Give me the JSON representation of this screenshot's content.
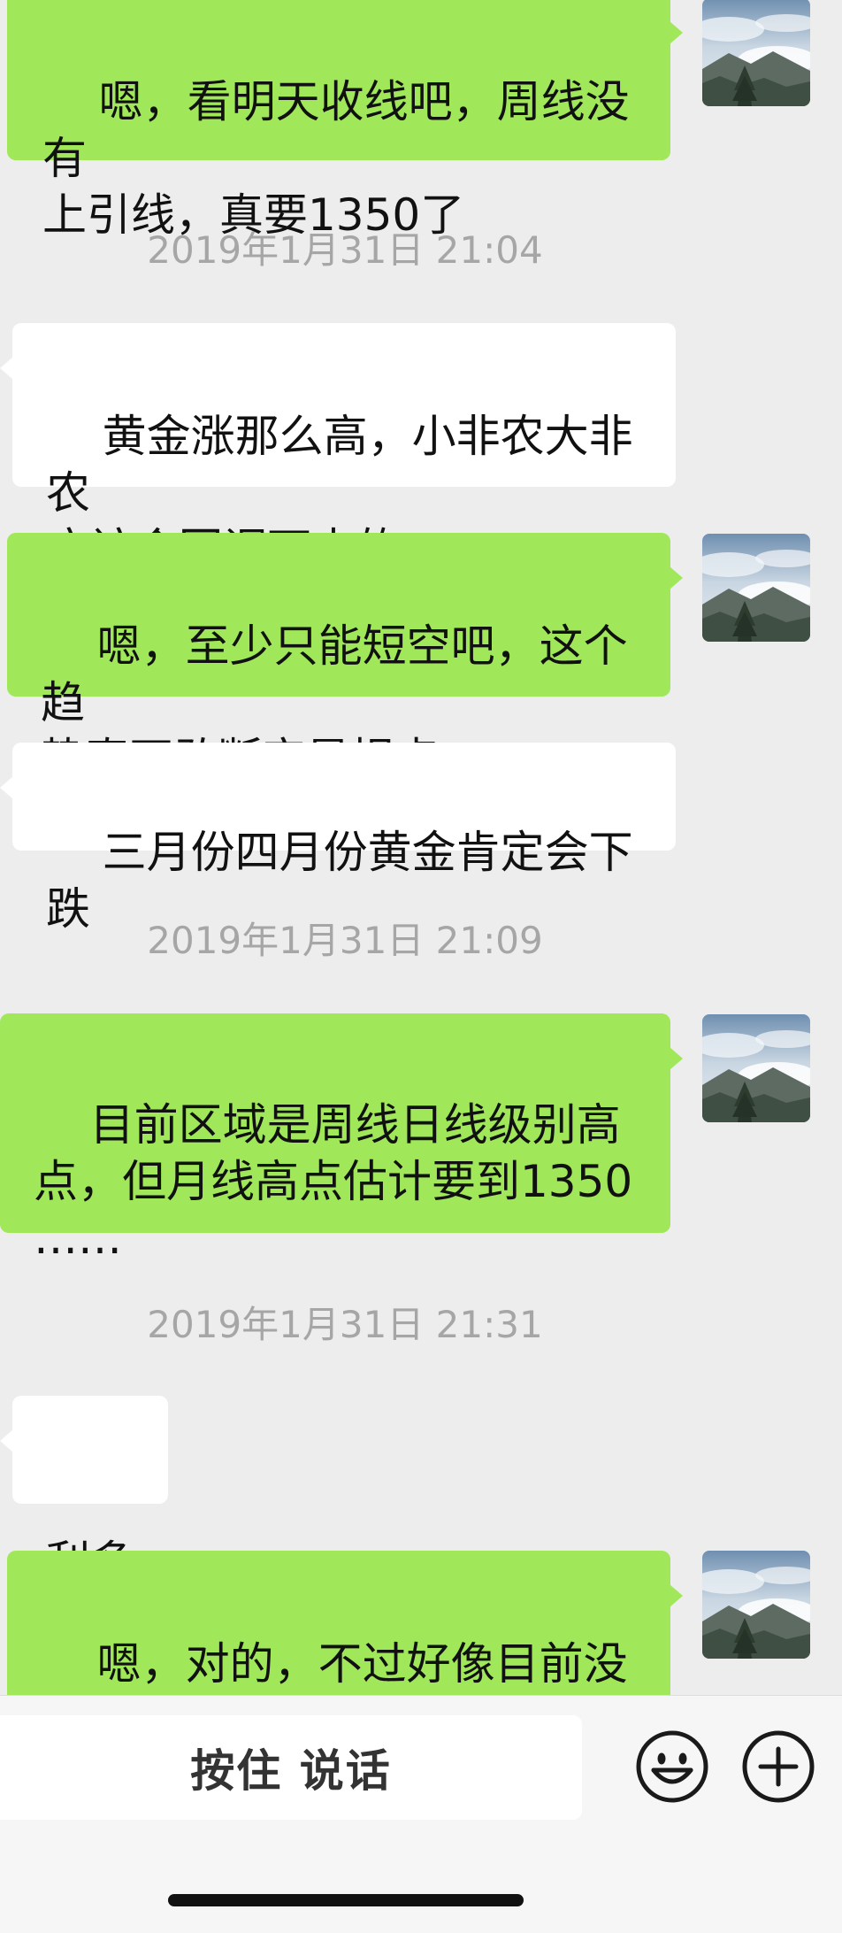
{
  "messages": [
    {
      "text": "嗯，看明天收线吧，周线没有\n上引线，真要1350了"
    },
    {
      "text": "2019年1月31日 21:04"
    },
    {
      "text": "黄金涨那么高，小非农大非农\n应该会回调下来的"
    },
    {
      "text": "嗯，至少只能短空吧，这个趋\n势真不敢断定是拐点"
    },
    {
      "text": "三月份四月份黄金肯定会下跌"
    },
    {
      "text": "2019年1月31日 21:09"
    },
    {
      "text": "目前区域是周线日线级别高\n点，但月线高点估计要到1350\n……"
    },
    {
      "text": "2019年1月31日 21:31"
    },
    {
      "text": "利多"
    },
    {
      "text": "嗯，对的，不过好像目前没涨\n上去"
    }
  ],
  "input_bar": {
    "hold_to_talk_label": "按住 说话",
    "emoji_icon": "smiley-face-icon",
    "more_icon": "plus-circle-icon"
  },
  "colors": {
    "outgoing_bubble": "#a0e75a",
    "incoming_bubble": "#ffffff",
    "chat_background": "#ededed",
    "timestamp_text": "#a6a6a6"
  }
}
